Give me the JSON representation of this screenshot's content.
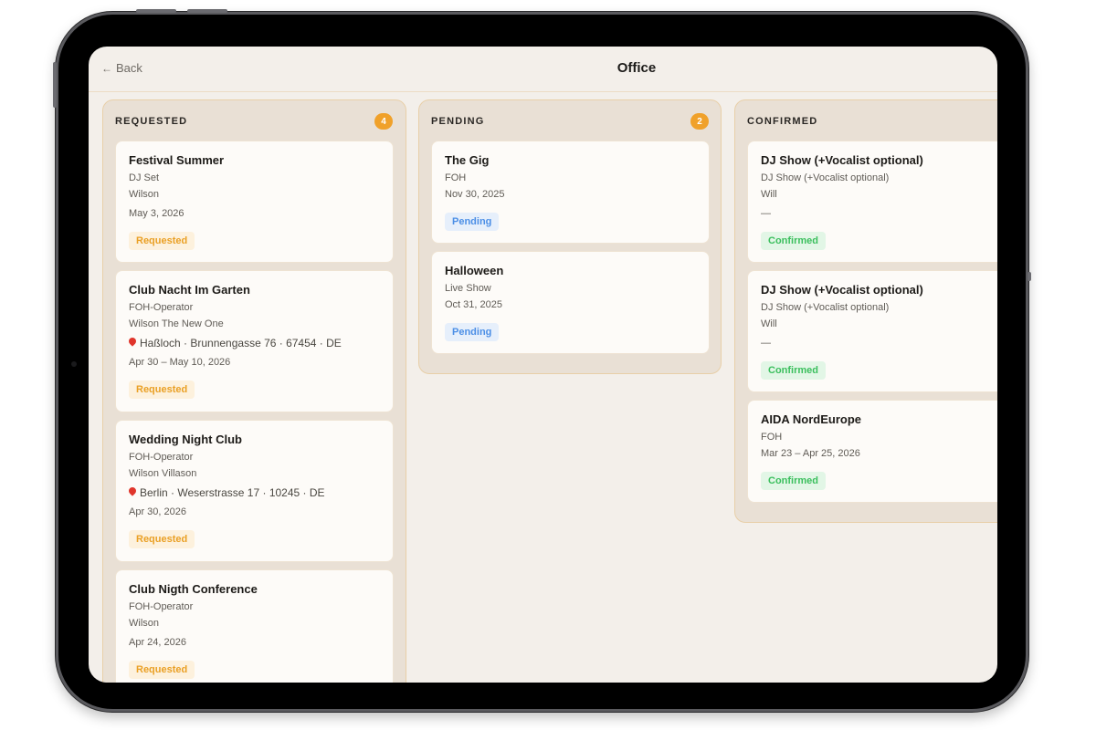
{
  "header": {
    "back_label": "Back",
    "title": "Office"
  },
  "columns": [
    {
      "name": "REQUESTED",
      "count": "4",
      "cards": [
        {
          "title": "Festival Summer",
          "role": "DJ Set",
          "person": "Wilson",
          "location": "",
          "date": "May 3, 2026",
          "status": "Requested"
        },
        {
          "title": "Club Nacht Im Garten",
          "role": "FOH-Operator",
          "person": "Wilson The New One",
          "location": "Haßloch · Brunnengasse 76 · 67454 · DE",
          "date": "Apr 30 – May 10, 2026",
          "status": "Requested"
        },
        {
          "title": "Wedding Night Club",
          "role": "FOH-Operator",
          "person": "Wilson Villason",
          "location": "Berlin · Weserstrasse 17 · 10245 · DE",
          "date": "Apr 30, 2026",
          "status": "Requested"
        },
        {
          "title": "Club Nigth Conference",
          "role": "FOH-Operator",
          "person": "Wilson",
          "location": "",
          "date": "Apr 24, 2026",
          "status": "Requested"
        }
      ]
    },
    {
      "name": "PENDING",
      "count": "2",
      "cards": [
        {
          "title": "The Gig",
          "role": "FOH",
          "date": "Nov 30, 2025",
          "status": "Pending"
        },
        {
          "title": "Halloween",
          "role": "Live Show",
          "date": "Oct 31, 2025",
          "status": "Pending"
        }
      ]
    },
    {
      "name": "CONFIRMED",
      "count": "",
      "cards": [
        {
          "title": "DJ Show (+Vocalist optional)",
          "role": "DJ Show (+Vocalist optional)",
          "person": "Will",
          "date": "—",
          "status": "Confirmed"
        },
        {
          "title": "DJ Show (+Vocalist optional)",
          "role": "DJ Show (+Vocalist optional)",
          "person": "Will",
          "date": "—",
          "status": "Confirmed"
        },
        {
          "title": "AIDA NordEurope",
          "role": "FOH",
          "date": "Mar 23 – Apr 25, 2026",
          "status": "Confirmed"
        }
      ]
    }
  ],
  "colors": {
    "badge_requested": "#eaa025",
    "badge_pending": "#4c8fe6",
    "badge_confirmed": "#3bbf5d",
    "count_badge": "#f0a12a",
    "pin": "#e0352b"
  },
  "icons": {
    "back": "arrow-left-icon",
    "location": "map-pin-icon"
  }
}
